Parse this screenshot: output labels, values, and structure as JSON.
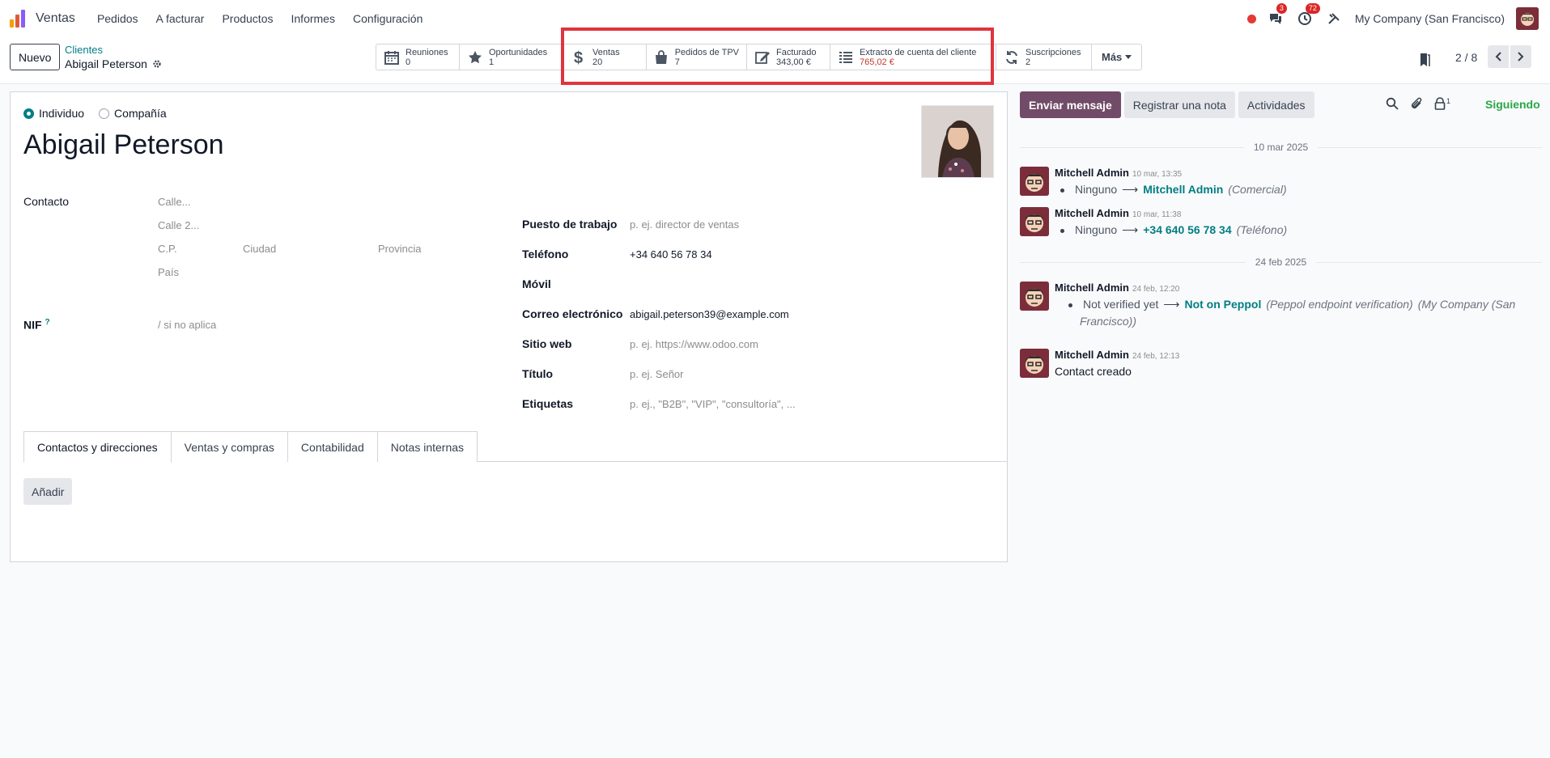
{
  "navbar": {
    "app_name": "Ventas",
    "menu": [
      "Pedidos",
      "A facturar",
      "Productos",
      "Informes",
      "Configuración"
    ],
    "chat_badge": "3",
    "activity_badge": "72",
    "company": "My Company (San Francisco)"
  },
  "control": {
    "new_label": "Nuevo",
    "breadcrumb_parent": "Clientes",
    "breadcrumb_current": "Abigail Peterson",
    "pager": "2 / 8",
    "smart_buttons": [
      {
        "label": "Reuniones",
        "value": "0",
        "icon": "calendar-icon"
      },
      {
        "label": "Oportunidades",
        "value": "1",
        "icon": "star-icon"
      },
      {
        "label": "Ventas",
        "value": "20",
        "icon": "dollar-icon"
      },
      {
        "label": "Pedidos de TPV",
        "value": "7",
        "icon": "shopping-bag-icon"
      },
      {
        "label": "Facturado",
        "value": "343,00 €",
        "icon": "pencil-square-icon"
      },
      {
        "label": "Extracto de cuenta del cliente",
        "value": "765,02 €",
        "icon": "list-icon"
      },
      {
        "label": "Suscripciones",
        "value": "2",
        "icon": "refresh-icon"
      }
    ],
    "more_label": "Más"
  },
  "form": {
    "type_individual": "Individuo",
    "type_company": "Compañía",
    "name": "Abigail Peterson",
    "contact_label": "Contacto",
    "street_ph": "Calle...",
    "street2_ph": "Calle 2...",
    "zip_ph": "C.P.",
    "city_ph": "Ciudad",
    "state_ph": "Provincia",
    "country_ph": "País",
    "vat_label": "NIF",
    "vat_help": "?",
    "vat_ph": "/ si no aplica",
    "job_label": "Puesto de trabajo",
    "job_ph": "p. ej. director de ventas",
    "phone_label": "Teléfono",
    "phone_value": "+34 640 56 78 34",
    "mobile_label": "Móvil",
    "email_label": "Correo electrónico",
    "email_value": "abigail.peterson39@example.com",
    "website_label": "Sitio web",
    "website_ph": "p. ej. https://www.odoo.com",
    "title_label": "Título",
    "title_ph": "p. ej. Señor",
    "tags_label": "Etiquetas",
    "tags_ph": "p. ej., \"B2B\", \"VIP\", \"consultoría\", ...",
    "tabs": [
      "Contactos y direcciones",
      "Ventas y compras",
      "Contabilidad",
      "Notas internas"
    ],
    "add_label": "Añadir"
  },
  "chatter": {
    "send_label": "Enviar mensaje",
    "note_label": "Registrar una nota",
    "activities_label": "Actividades",
    "followers_count": "1",
    "following_label": "Siguiendo",
    "date1": "10 mar 2025",
    "date2": "24 feb 2025",
    "messages": [
      {
        "author": "Mitchell Admin",
        "time": "10 mar, 13:35",
        "old": "Ninguno",
        "new": "Mitchell Admin",
        "field": "(Comercial)"
      },
      {
        "author": "Mitchell Admin",
        "time": "10 mar, 11:38",
        "old": "Ninguno",
        "new": "+34 640 56 78 34",
        "field": "(Teléfono)"
      },
      {
        "author": "Mitchell Admin",
        "time": "24 feb, 12:20",
        "old": "Not verified yet",
        "new": "Not on Peppol",
        "field": "(Peppol endpoint verification)",
        "field2": "(My Company (San",
        "field3": "Francisco))"
      },
      {
        "author": "Mitchell Admin",
        "time": "24 feb, 12:13",
        "body": "Contact creado"
      }
    ]
  },
  "colors": {
    "primary": "#714b67",
    "accent": "#017e84",
    "highlight": "#e0343c",
    "following": "#28a745"
  }
}
